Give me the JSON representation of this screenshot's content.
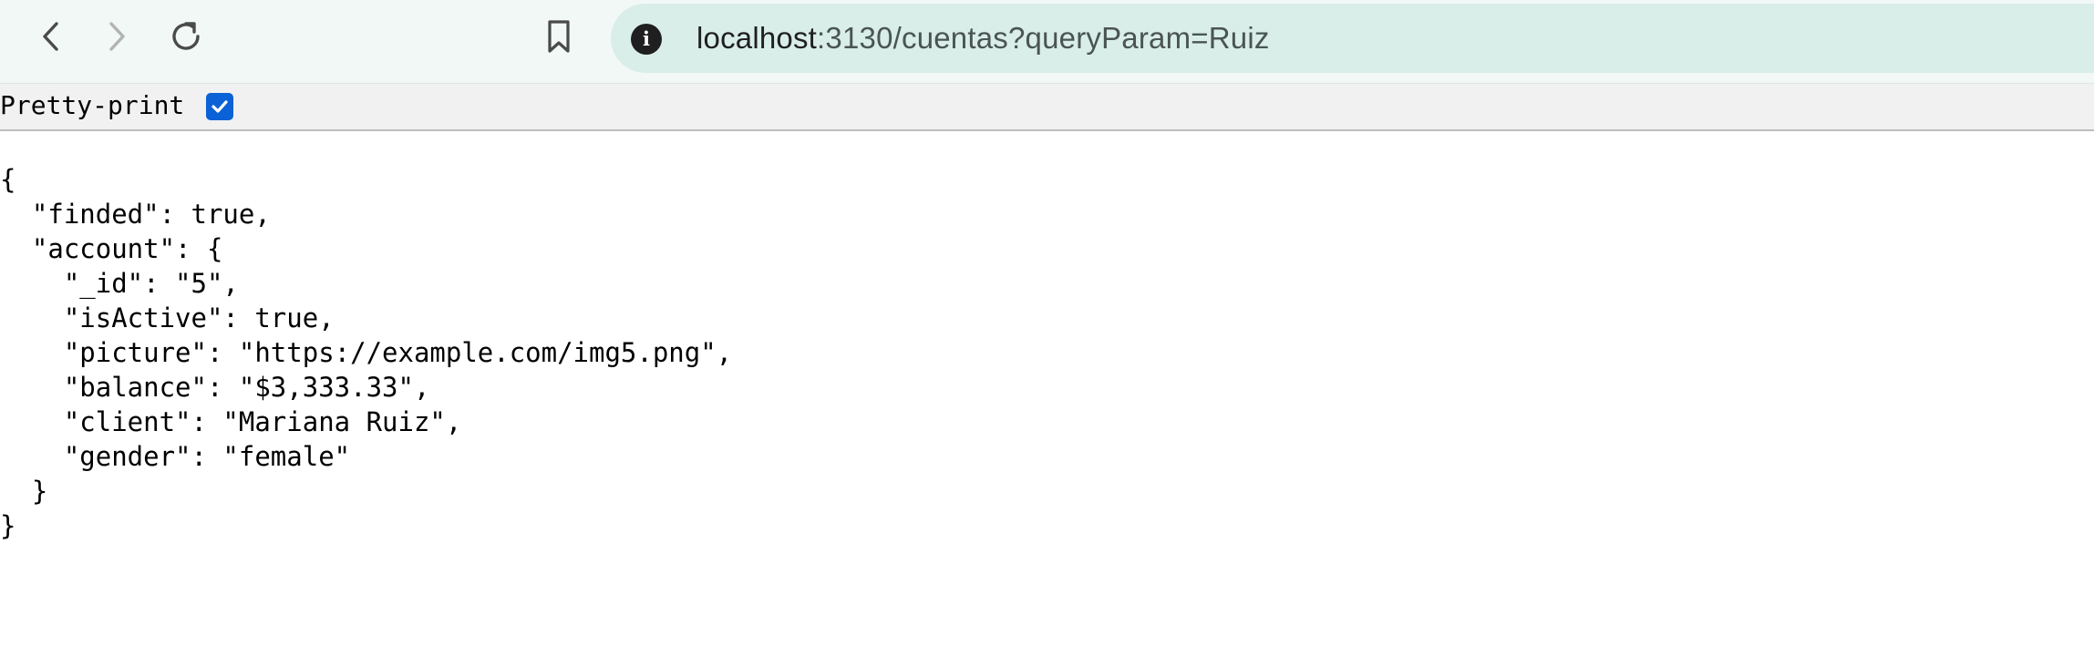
{
  "browser": {
    "url_host": "localhost",
    "url_rest": ":3130/cuentas?queryParam=Ruiz",
    "icons": {
      "back": "chevron-left-icon",
      "forward": "chevron-right-icon",
      "reload": "reload-icon",
      "bookmark": "bookmark-icon",
      "info": "info-icon"
    },
    "info_glyph": "i"
  },
  "viewer": {
    "pretty_print_label": "Pretty-print",
    "pretty_print_checked": true
  },
  "json_lines": [
    "{",
    "  \"finded\": true,",
    "  \"account\": {",
    "    \"_id\": \"5\",",
    "    \"isActive\": true,",
    "    \"picture\": \"https://example.com/img5.png\",",
    "    \"balance\": \"$3,333.33\",",
    "    \"client\": \"Mariana Ruiz\",",
    "    \"gender\": \"female\"",
    "  }",
    "}"
  ],
  "colors": {
    "toolbar_bg": "#f1f8f6",
    "address_bg": "#d9eee9",
    "checkbox_accent": "#0b61d6"
  }
}
